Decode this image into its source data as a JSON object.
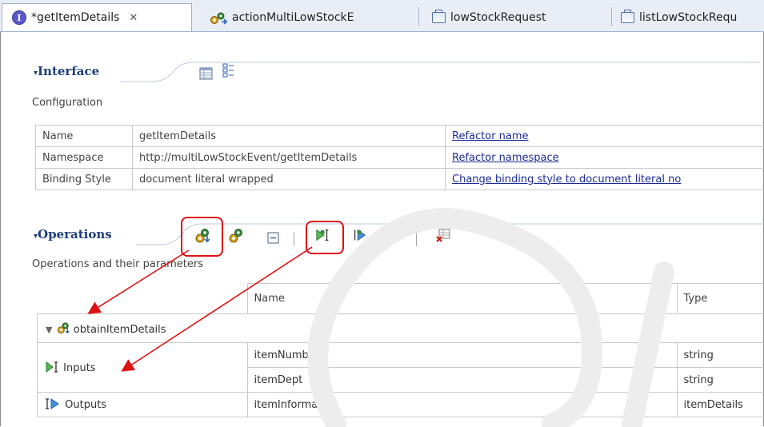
{
  "tabs": [
    {
      "label": "*getItemDetails",
      "icon": "interface-icon",
      "closable": true
    },
    {
      "label": "actionMultiLowStockE",
      "icon": "process-icon"
    },
    {
      "label": "lowStockRequest",
      "icon": "business-object-icon"
    },
    {
      "label": "listLowStockRequ",
      "icon": "business-object-icon"
    }
  ],
  "interface": {
    "title": "Interface",
    "subtitle": "Configuration",
    "rows": [
      {
        "label": "Name",
        "value": "getItemDetails",
        "action": "Refactor name"
      },
      {
        "label": "Namespace",
        "value": "http://multiLowStockEvent/getItemDetails",
        "action": "Refactor namespace"
      },
      {
        "label": "Binding Style",
        "value": "document literal wrapped",
        "action": "Change binding style to document literal no"
      }
    ]
  },
  "operations": {
    "title": "Operations",
    "subtitle": "Operations and their parameters",
    "columns": {
      "name": "Name",
      "type": "Type"
    },
    "operation_name": "obtainItemDetails",
    "inputs_label": "Inputs",
    "outputs_label": "Outputs",
    "inputs": [
      {
        "name": "itemNumber",
        "type": "string"
      },
      {
        "name": "itemDept",
        "type": "string"
      }
    ],
    "outputs": [
      {
        "name": "itemInformation",
        "type": "itemDetails"
      }
    ]
  },
  "colors": {
    "annotation": "#e01010",
    "header_text": "#1c3f7a",
    "link": "#1b2a9a"
  }
}
